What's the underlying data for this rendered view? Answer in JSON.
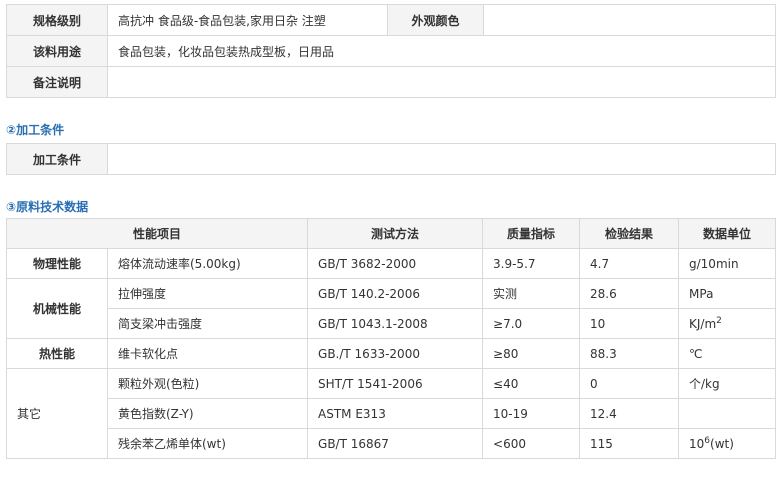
{
  "basic": {
    "spec_label": "规格级别",
    "spec_value": "高抗冲 食品级-食品包装,家用日杂 注塑",
    "color_label": "外观颜色",
    "color_value": "",
    "usage_label": "该料用途",
    "usage_value": "食品包装，化妆品包装热成型板，日用品",
    "notes_label": "备注说明",
    "notes_value": ""
  },
  "section2": {
    "title": "②加工条件",
    "label": "加工条件",
    "value": ""
  },
  "section3": {
    "title": "③原料技术数据"
  },
  "data_table": {
    "headers": [
      "性能项目",
      "测试方法",
      "质量指标",
      "检验结果",
      "数据单位"
    ],
    "groups": [
      "物理性能",
      "机械性能",
      "热性能",
      "其它"
    ],
    "rows": [
      {
        "item": "熔体流动速率(5.00kg)",
        "method": "GB/T 3682-2000",
        "spec": "3.9-5.7",
        "result": "4.7",
        "unit": "g/10min"
      },
      {
        "item": "拉伸强度",
        "method": "GB/T 140.2-2006",
        "spec": "实测",
        "result": "28.6",
        "unit": "MPa"
      },
      {
        "item": "简支梁冲击强度",
        "method": "GB/T 1043.1-2008",
        "spec": "≥7.0",
        "result": "10",
        "unit": "KJ/m",
        "unit_sup": "2"
      },
      {
        "item": "维卡软化点",
        "method": "GB./T 1633-2000",
        "spec": "≥80",
        "result": "88.3",
        "unit": "℃"
      },
      {
        "item": "颗粒外观(色粒)",
        "method": "SHT/T 1541-2006",
        "spec": "≤40",
        "result": "0",
        "unit": "个/kg"
      },
      {
        "item": "黄色指数(Z-Y)",
        "method": "ASTM E313",
        "spec": "10-19",
        "result": "12.4",
        "unit": ""
      },
      {
        "item": "残余苯乙烯单体(wt)",
        "method": "GB/T 16867",
        "spec": "<600",
        "result": "115",
        "unit": "10",
        "unit_sup": "6",
        "unit_suffix": "(wt)"
      }
    ]
  }
}
